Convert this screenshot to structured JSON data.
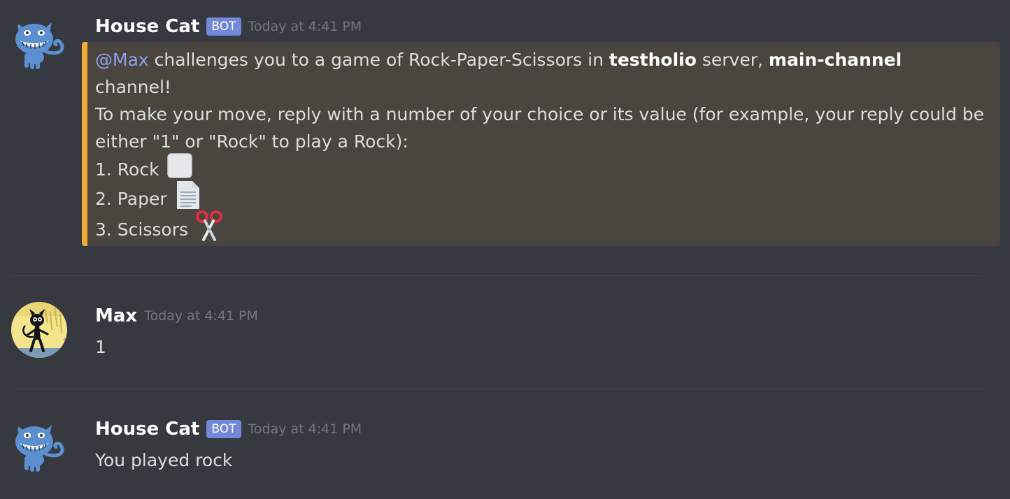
{
  "messages": [
    {
      "author": "House Cat",
      "bot_tag": "BOT",
      "timestamp": "Today at 4:41 PM",
      "avatar": "cheshire-cat-icon",
      "embed": {
        "accent_color": "#f3a935",
        "mention": "@Max",
        "line1_a": " challenges you to a game of Rock-Paper-Scissors in ",
        "server": "testholio",
        "line1_b": " server, ",
        "channel": "main-channel",
        "line2": "channel!",
        "line3": "To make your move, reply with a number of your choice or its value (for example, your reply could be",
        "line4": "either \"1\" or \"Rock\" to play a Rock):",
        "options": [
          {
            "label": "1. Rock",
            "icon": "rock-emoji"
          },
          {
            "label": "2. Paper",
            "icon": "page-emoji"
          },
          {
            "label": "3. Scissors",
            "icon": "scissors-emoji"
          }
        ]
      }
    },
    {
      "author": "Max",
      "timestamp": "Today at 4:41 PM",
      "avatar": "black-cat-avatar",
      "content": "1"
    },
    {
      "author": "House Cat",
      "bot_tag": "BOT",
      "timestamp": "Today at 4:41 PM",
      "avatar": "cheshire-cat-icon",
      "content": "You played rock"
    }
  ],
  "colors": {
    "background": "#36393f",
    "bot_tag": "#7289da",
    "mention": "#8c9fe8",
    "timestamp": "#72767d",
    "embed_bg": "#4a453e"
  }
}
